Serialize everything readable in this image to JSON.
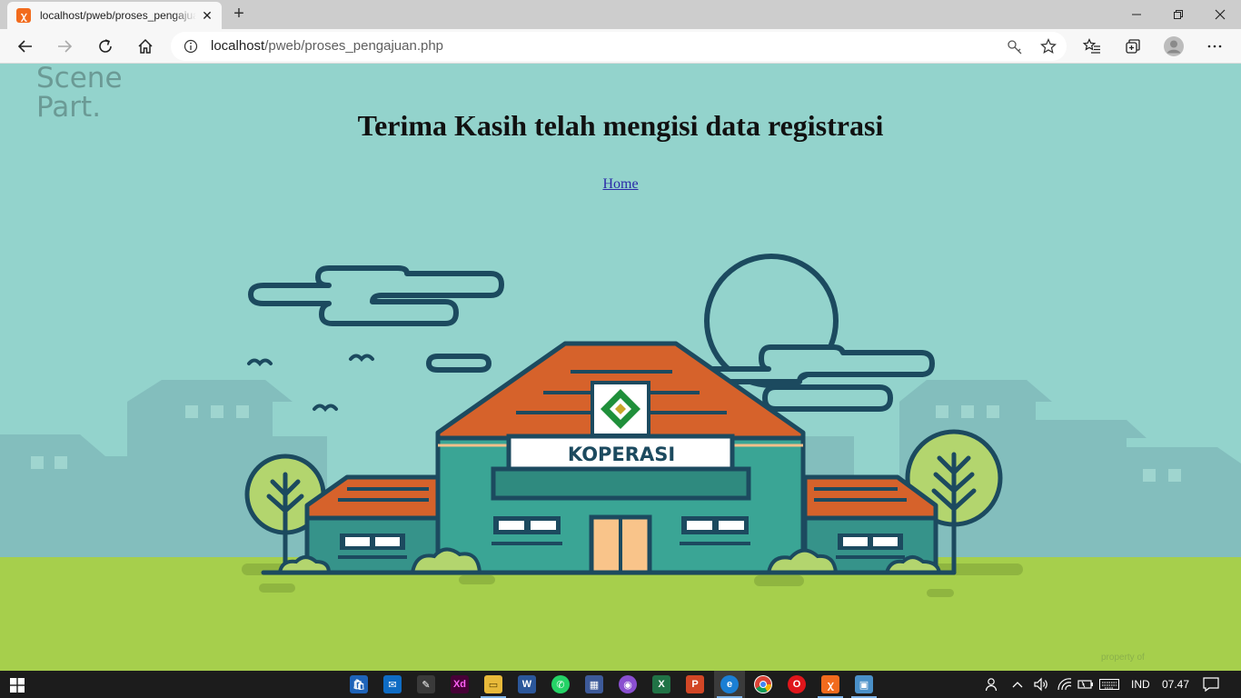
{
  "browser": {
    "tab_title": "localhost/pweb/proses_pengajuan.php",
    "tab_favicon_icon": "xampp-icon",
    "url_host": "localhost",
    "url_path": "/pweb/proses_pengajuan.php"
  },
  "page": {
    "watermark_line1": "Scene",
    "watermark_line2": "Part.",
    "heading": "Terima Kasih telah mengisi data registrasi",
    "home_link": "Home",
    "building_sign": "KOPERASI",
    "credit": "property of"
  },
  "taskbar": {
    "apps": [
      "store-icon",
      "mail-icon",
      "pen-icon",
      "xd-icon",
      "file-explorer-icon",
      "word-icon",
      "whatsapp-icon",
      "calendar-icon",
      "twitch-icon",
      "excel-icon",
      "powerpoint-icon",
      "edge-icon",
      "chrome-icon",
      "opera-icon",
      "xampp-icon",
      "control-panel-icon"
    ],
    "language": "IND",
    "clock": "07.47"
  },
  "colors": {
    "sky": "#93d3cc",
    "grass": "#a6cf4c",
    "roof": "#d6622b",
    "building": "#3aa595",
    "outline": "#1c4a5f"
  }
}
